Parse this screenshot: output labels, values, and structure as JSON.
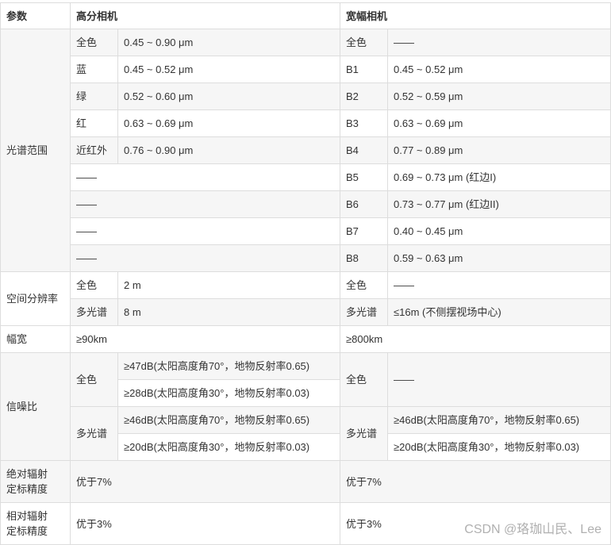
{
  "header": {
    "param": "参数",
    "hr": "高分相机",
    "wide": "宽幅相机"
  },
  "spectral": {
    "label": "光谱范围",
    "rows": [
      {
        "hb": "全色",
        "hv": "0.45 ~ 0.90 μm",
        "wb": "全色",
        "wv": "——"
      },
      {
        "hb": "蓝",
        "hv": "0.45 ~ 0.52 μm",
        "wb": "B1",
        "wv": "0.45 ~ 0.52 μm"
      },
      {
        "hb": "绿",
        "hv": "0.52 ~ 0.60 μm",
        "wb": "B2",
        "wv": "0.52 ~ 0.59 μm"
      },
      {
        "hb": "红",
        "hv": "0.63 ~ 0.69 μm",
        "wb": "B3",
        "wv": "0.63 ~ 0.69 μm"
      },
      {
        "hb": "近红外",
        "hv": "0.76 ~ 0.90 μm",
        "wb": "B4",
        "wv": "0.77 ~ 0.89 μm"
      },
      {
        "hb": "——",
        "wb": "B5",
        "wv": "0.69 ~ 0.73 μm (红边I)"
      },
      {
        "hb": "——",
        "wb": "B6",
        "wv": "0.73 ~ 0.77 μm (红边II)"
      },
      {
        "hb": "——",
        "wb": "B7",
        "wv": "0.40 ~ 0.45 μm"
      },
      {
        "hb": "——",
        "wb": "B8",
        "wv": "0.59 ~ 0.63 μm"
      }
    ]
  },
  "resolution": {
    "label": "空间分辨率",
    "rows": [
      {
        "hb": "全色",
        "hv": "2 m",
        "wb": "全色",
        "wv": "——"
      },
      {
        "hb": "多光谱",
        "hv": "8 m",
        "wb": "多光谱",
        "wv": "≤16m (不侧摆视场中心)"
      }
    ]
  },
  "swath": {
    "label": "幅宽",
    "hv": "≥90km",
    "wv": "≥800km"
  },
  "snr": {
    "label": "信噪比",
    "pan": "全色",
    "ms": "多光谱",
    "h": [
      "≥47dB(太阳高度角70°，地物反射率0.65)",
      "≥28dB(太阳高度角30°，地物反射率0.03)",
      "≥46dB(太阳高度角70°，地物反射率0.65)",
      "≥20dB(太阳高度角30°，地物反射率0.03)"
    ],
    "w_pan": "——",
    "w": [
      "≥46dB(太阳高度角70°，地物反射率0.65)",
      "≥20dB(太阳高度角30°，地物反射率0.03)"
    ]
  },
  "abs": {
    "l1": "绝对辐射",
    "l2": "定标精度",
    "hv": "优于7%",
    "wv": "优于7%"
  },
  "rel": {
    "l1": "相对辐射",
    "l2": "定标精度",
    "hv": "优于3%",
    "wv": "优于3%"
  },
  "watermark": "CSDN @珞珈山民、Lee"
}
